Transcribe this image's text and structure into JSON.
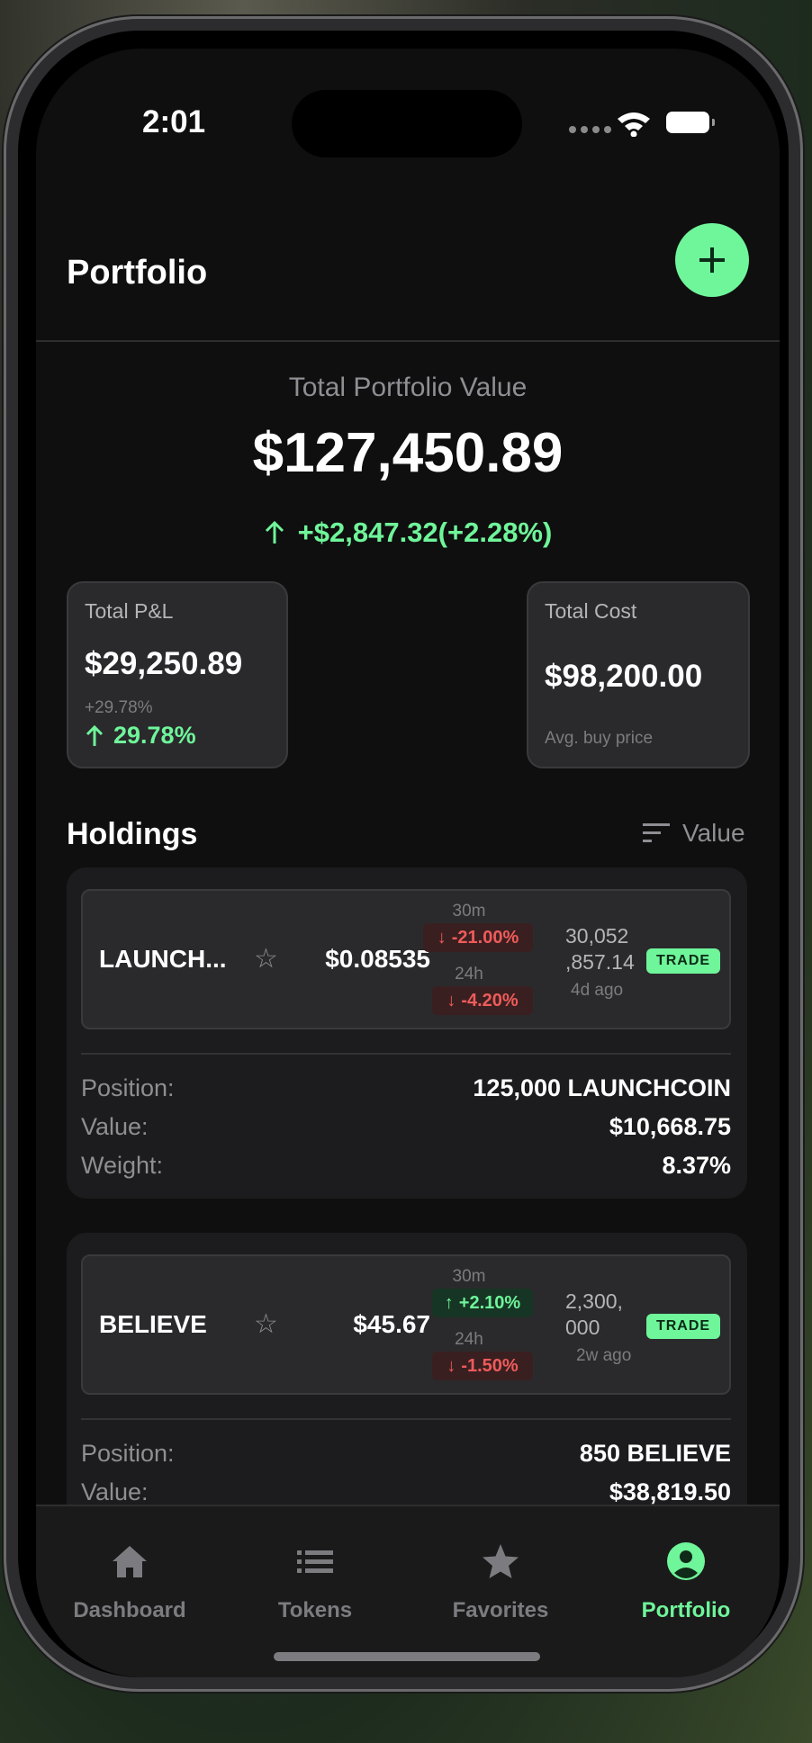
{
  "status_bar": {
    "time": "2:01"
  },
  "header": {
    "title": "Portfolio",
    "add_icon": "plus-icon"
  },
  "summary": {
    "label": "Total Portfolio Value",
    "value": "$127,450.89",
    "change": "+$2,847.32(+2.28%)",
    "change_direction": "up"
  },
  "pnl_card": {
    "label": "Total P&L",
    "value": "$29,250.89",
    "sub": "+29.78%",
    "pct": "29.78%"
  },
  "cost_card": {
    "label": "Total Cost",
    "value": "$98,200.00",
    "sub": "Avg. buy price"
  },
  "holdings": {
    "title": "Holdings",
    "sort_label": "Value",
    "items": [
      {
        "name": "LAUNCH...",
        "price": "$0.08535",
        "tf1_label": "30m",
        "tf1_change": "-21.00%",
        "tf2_label": "24h",
        "tf2_change": "-4.20%",
        "volume": "30,052 ,857.14",
        "age": "4d ago",
        "trade_label": "TRADE",
        "position_key": "Position:",
        "position": "125,000 LAUNCHCOIN",
        "value_key": "Value:",
        "value": "$10,668.75",
        "weight_key": "Weight:",
        "weight": "8.37%"
      },
      {
        "name": "BELIEVE",
        "price": "$45.67",
        "tf1_label": "30m",
        "tf1_change": "+2.10%",
        "tf2_label": "24h",
        "tf2_change": "-1.50%",
        "volume": "2,300, 000",
        "age": "2w ago",
        "trade_label": "TRADE",
        "position_key": "Position:",
        "position": "850 BELIEVE",
        "value_key": "Value:",
        "value": "$38,819.50"
      }
    ]
  },
  "tab_bar": {
    "tabs": [
      {
        "label": "Dashboard",
        "icon": "home-icon"
      },
      {
        "label": "Tokens",
        "icon": "list-icon"
      },
      {
        "label": "Favorites",
        "icon": "star-icon"
      },
      {
        "label": "Portfolio",
        "icon": "user-circle-icon",
        "active": true
      }
    ]
  },
  "colors": {
    "accent": "#6ff59a",
    "negative": "#ef5b5b",
    "background": "#0f0f0f",
    "card": "#1c1c1e"
  }
}
